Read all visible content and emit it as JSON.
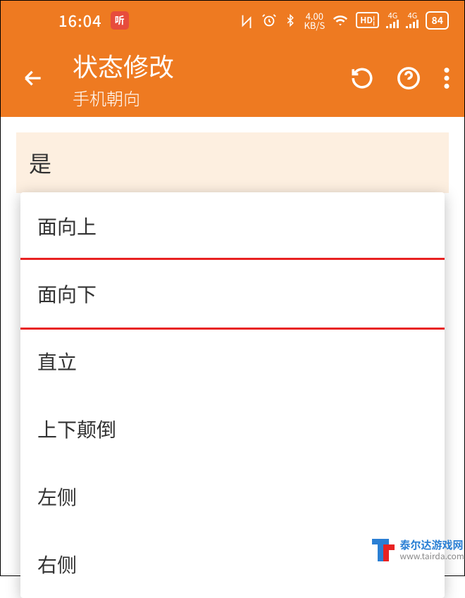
{
  "status_bar": {
    "time": "16:04",
    "ting_label": "听",
    "kbs_value": "4.00",
    "kbs_unit": "KB/S",
    "hd": "HD",
    "sig_label": "4G",
    "battery": "84"
  },
  "app_bar": {
    "title": "状态修改",
    "subtitle": "手机朝向"
  },
  "content": {
    "current_value": "是"
  },
  "dropdown": {
    "items": [
      "面向上",
      "面向下",
      "直立",
      "上下颠倒",
      "左侧",
      "右侧"
    ],
    "highlighted_index": 1
  },
  "watermark": {
    "name": "泰尔达游戏网",
    "url": "www.tairda.com"
  }
}
